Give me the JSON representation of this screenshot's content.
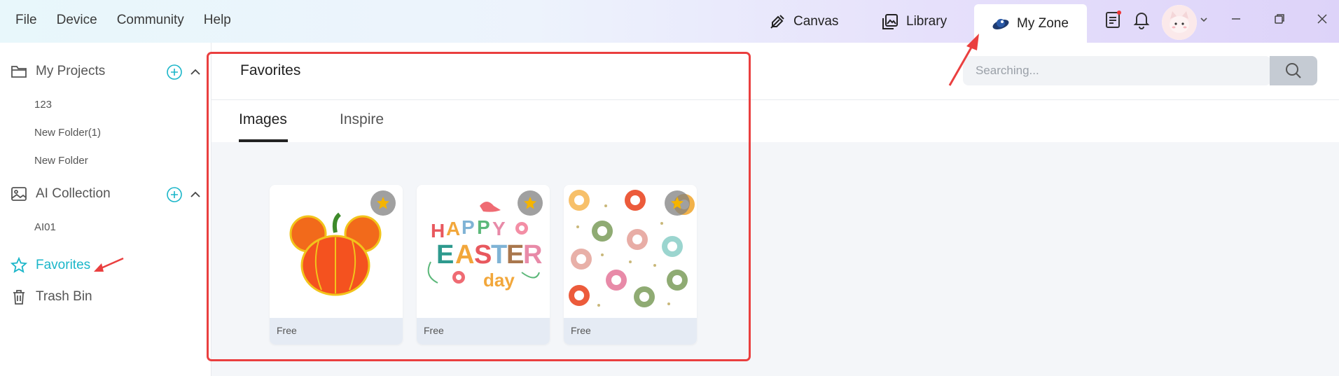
{
  "menu": {
    "file": "File",
    "device": "Device",
    "community": "Community",
    "help": "Help"
  },
  "nav": {
    "canvas": "Canvas",
    "library": "Library",
    "my_zone": "My Zone"
  },
  "sidebar": {
    "my_projects": "My Projects",
    "project_items": [
      "123",
      "New Folder(1)",
      "New Folder"
    ],
    "ai_collection": "AI Collection",
    "ai_items": [
      "AI01"
    ],
    "favorites": "Favorites",
    "trash_bin": "Trash Bin"
  },
  "main": {
    "title": "Favorites",
    "tabs": [
      "Images",
      "Inspire"
    ],
    "search_placeholder": "Searching...",
    "cards": [
      {
        "label": "Free",
        "image": "pumpkin-illustration"
      },
      {
        "label": "Free",
        "image": "happy-easter-day-illustration"
      },
      {
        "label": "Free",
        "image": "smiley-flowers-pattern"
      }
    ]
  },
  "colors": {
    "accent": "#1bb6c9",
    "highlight": "#ea3f3f",
    "star": "#f5b400"
  },
  "icons": [
    "canvas-icon",
    "library-icon",
    "my-zone-icon",
    "clipboard-icon",
    "bell-icon",
    "search-icon",
    "folder-icon",
    "image-icon",
    "star-icon",
    "trash-icon"
  ]
}
